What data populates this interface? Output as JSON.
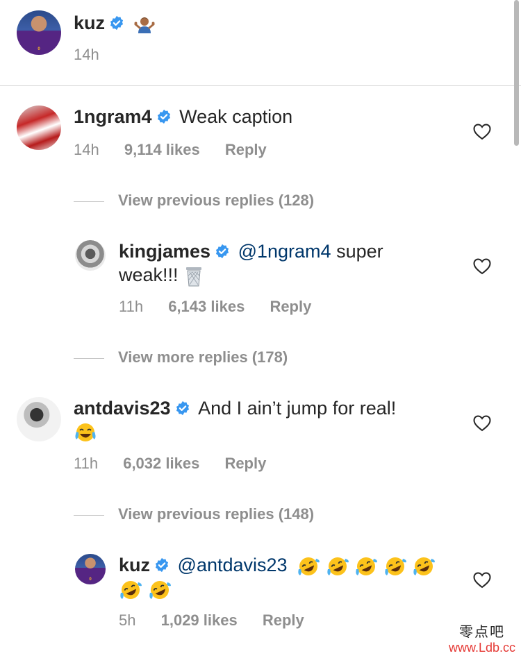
{
  "post": {
    "username": "kuz",
    "time": "14h"
  },
  "comments": [
    {
      "username": "1ngram4",
      "text": "Weak caption",
      "time": "14h",
      "likes": "9,114 likes",
      "reply": "Reply",
      "view_replies": "View previous replies (128)"
    },
    {
      "username": "kingjames",
      "mention": "@1ngram4",
      "text": "super",
      "text2": "weak!!!",
      "time": "11h",
      "likes": "6,143 likes",
      "reply": "Reply",
      "view_replies": "View more replies (178)"
    },
    {
      "username": "antdavis23",
      "text": "And I ain’t jump for real!",
      "time": "11h",
      "likes": "6,032 likes",
      "reply": "Reply",
      "view_replies": "View previous replies (148)"
    },
    {
      "username": "kuz",
      "mention": "@antdavis23",
      "time": "5h",
      "likes": "1,029 likes",
      "reply": "Reply"
    }
  ],
  "icons": {
    "verified": "verified-badge-icon",
    "heart": "heart-outline-icon",
    "shrug": "shrug-emoji-icon",
    "trash": "wastebasket-emoji-icon",
    "joy": "tears-of-joy-emoji-icon",
    "rofl": "rolling-on-floor-laughing-emoji-icon"
  },
  "colors": {
    "verified": "#3897f0",
    "mention": "#00376b",
    "meta": "#8e8e8e",
    "text": "#262626"
  },
  "watermark": {
    "chinese": "零点吧",
    "url": "www.Ldb.cc"
  }
}
